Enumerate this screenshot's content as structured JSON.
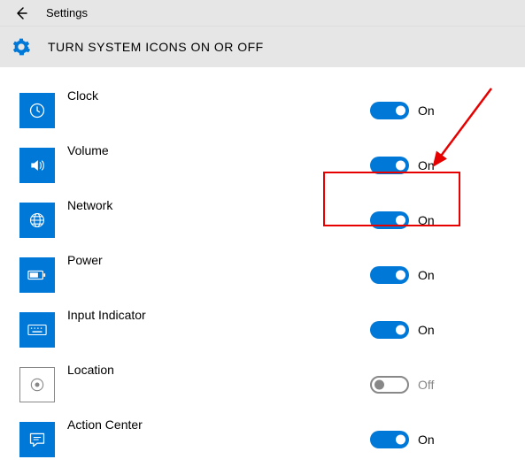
{
  "header": {
    "title": "Settings"
  },
  "page": {
    "title": "TURN SYSTEM ICONS ON OR OFF"
  },
  "states": {
    "on": "On",
    "off": "Off"
  },
  "items": [
    {
      "label": "Clock",
      "icon": "clock-icon",
      "state": "on"
    },
    {
      "label": "Volume",
      "icon": "volume-icon",
      "state": "on"
    },
    {
      "label": "Network",
      "icon": "network-icon",
      "state": "on"
    },
    {
      "label": "Power",
      "icon": "power-icon",
      "state": "on"
    },
    {
      "label": "Input Indicator",
      "icon": "keyboard-icon",
      "state": "on"
    },
    {
      "label": "Location",
      "icon": "location-icon",
      "state": "off"
    },
    {
      "label": "Action Center",
      "icon": "action-center-icon",
      "state": "on"
    }
  ],
  "annotation": {
    "highlight_index": 2
  }
}
